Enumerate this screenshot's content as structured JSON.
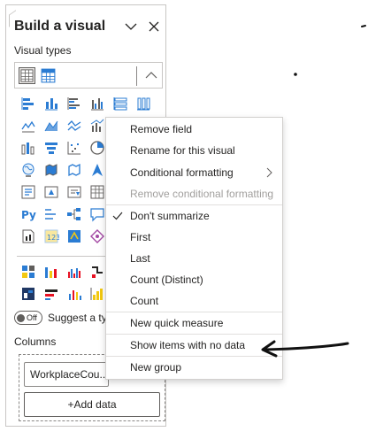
{
  "pane": {
    "title": "Build a visual",
    "visual_types_label": "Visual types",
    "collapse_icon": "chevron-down-icon",
    "close_icon": "close-icon",
    "suggest_toggle": {
      "state_text": "Off",
      "label": "Suggest a type"
    },
    "columns_label": "Columns",
    "field_pill": "WorkplaceCou...",
    "add_data_label": "+Add data"
  },
  "context_menu": {
    "items": [
      {
        "label": "Remove field",
        "disabled": false
      },
      {
        "label": "Rename for this visual",
        "disabled": false
      },
      {
        "label": "Conditional formatting",
        "disabled": false,
        "submenu": true
      },
      {
        "label": "Remove conditional formatting",
        "disabled": true
      },
      {
        "label": "Don't summarize",
        "checked": true
      },
      {
        "label": "First"
      },
      {
        "label": "Last"
      },
      {
        "label": "Count (Distinct)"
      },
      {
        "label": "Count"
      },
      {
        "label": "New quick measure"
      },
      {
        "label": "Show items with no data"
      },
      {
        "label": "New group"
      }
    ]
  },
  "colors": {
    "accent_blue": "#2b7cd3",
    "accent_yellow": "#f2c811",
    "annotation_ink": "#111111"
  }
}
